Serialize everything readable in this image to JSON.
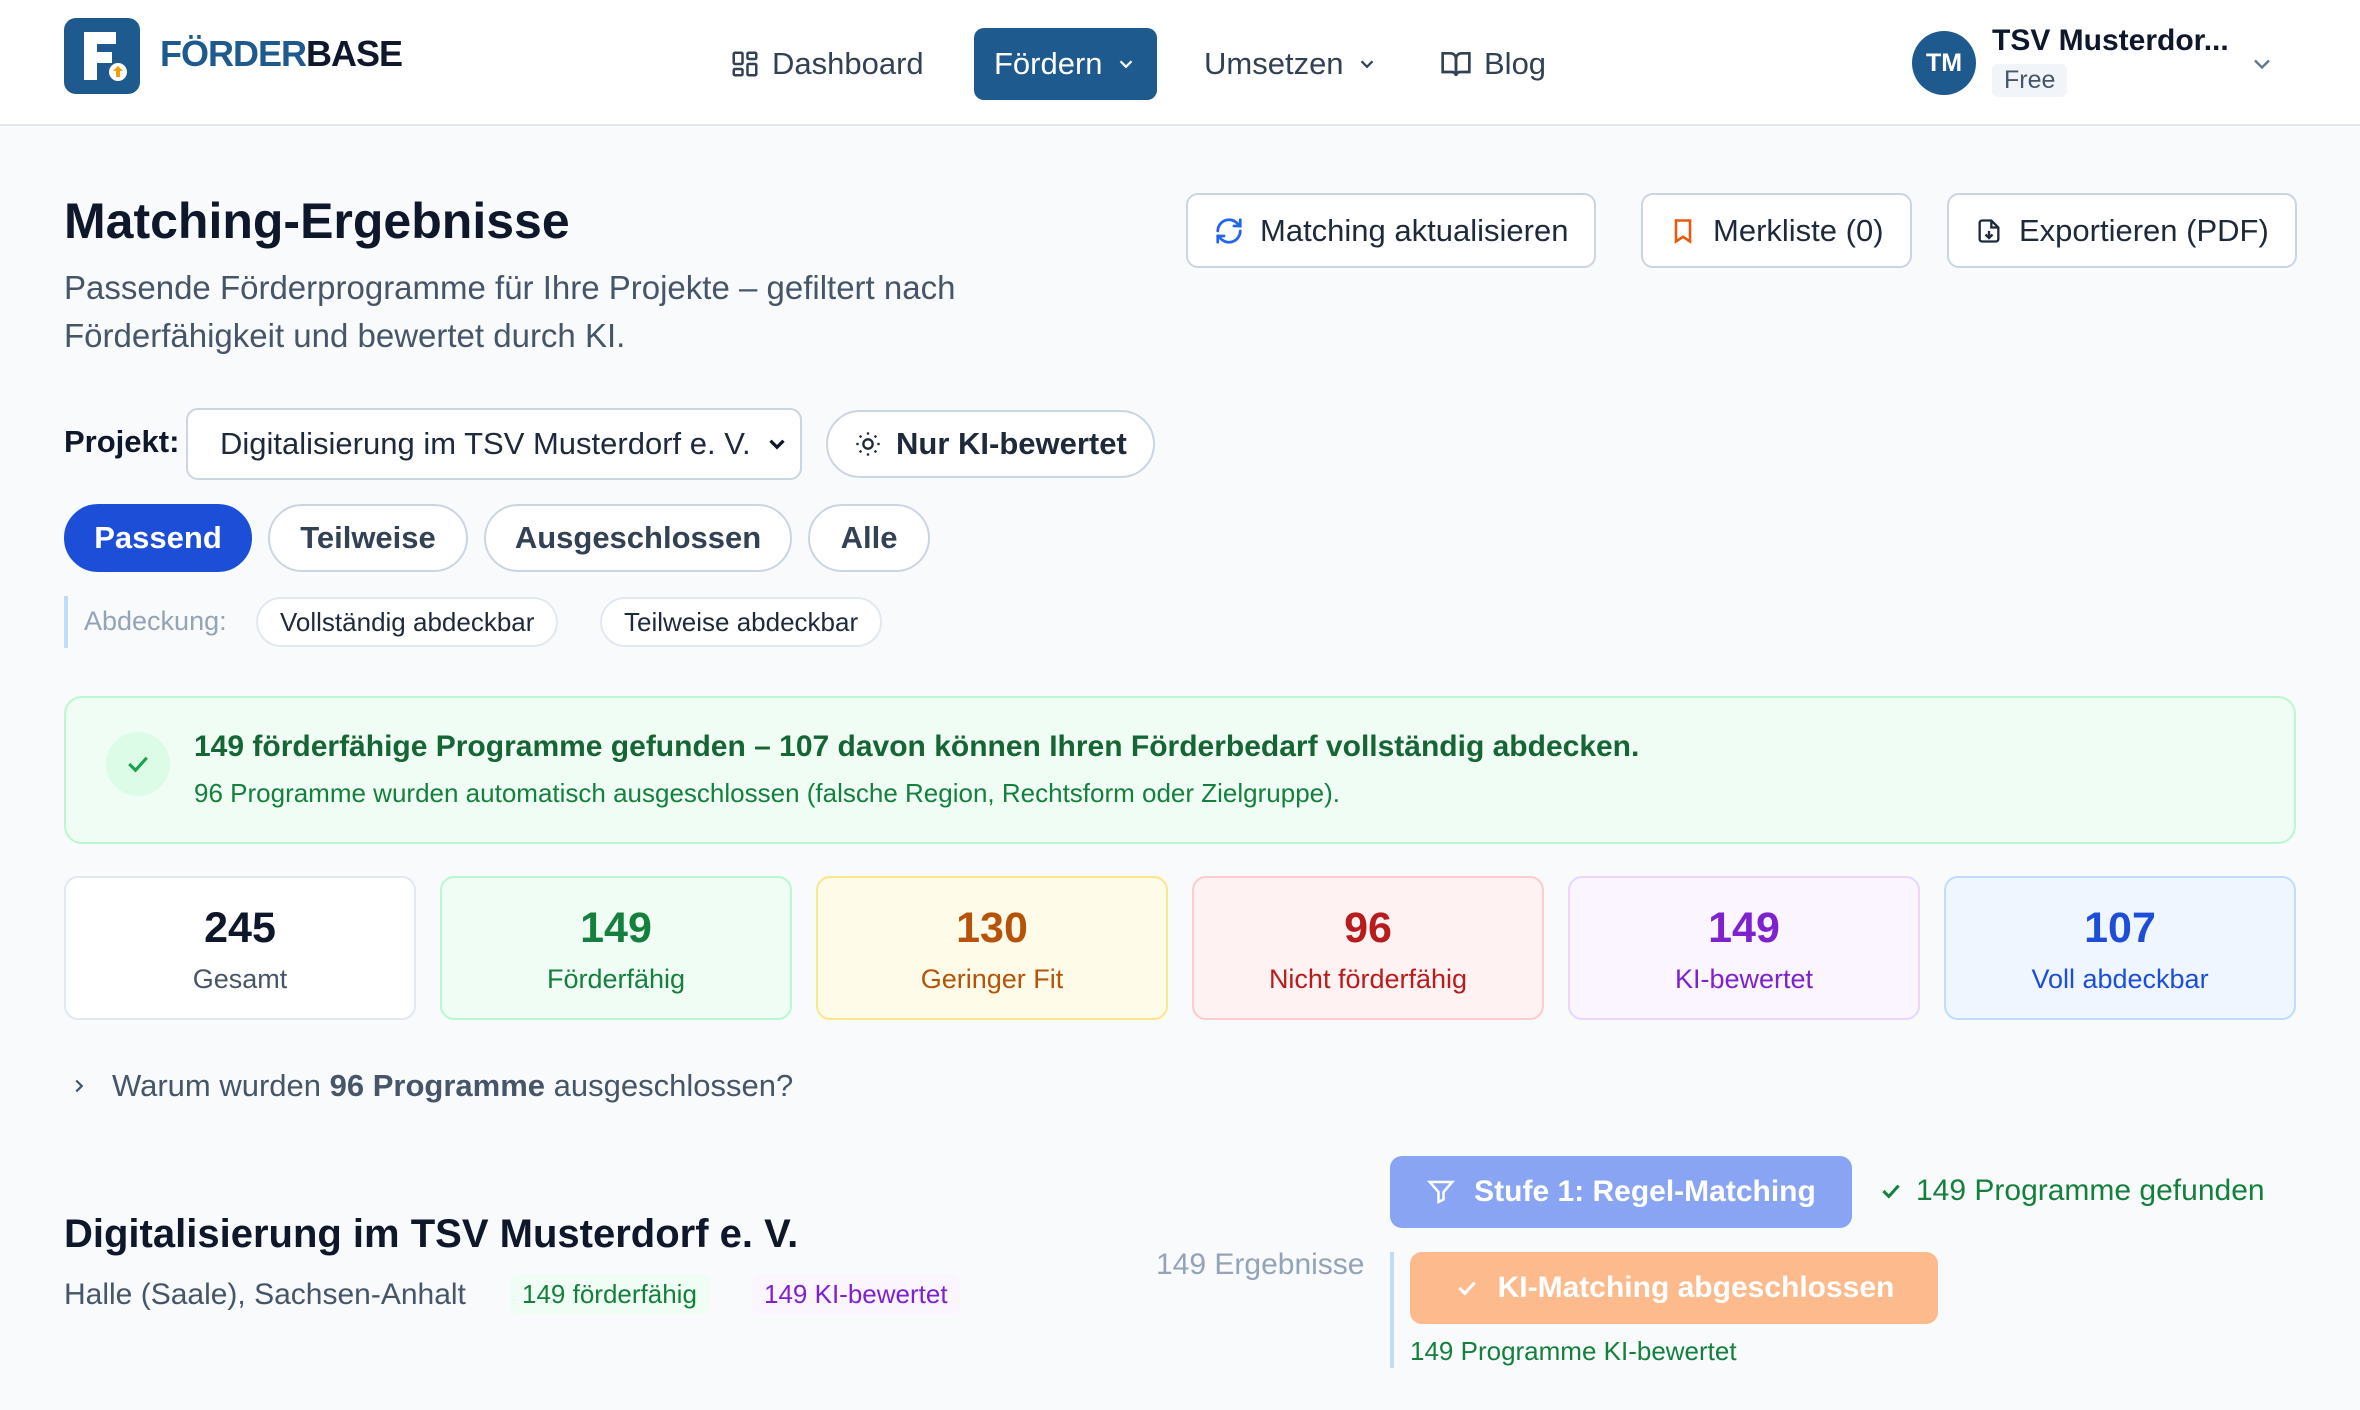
{
  "brand": {
    "name_part1": "FÖRDER",
    "name_part2": "BASE",
    "logo_letter": "F"
  },
  "nav": {
    "items": [
      {
        "label": "Dashboard",
        "icon": "grid-icon"
      },
      {
        "label": "Fördern",
        "icon": "chevron-down-icon",
        "active": true
      },
      {
        "label": "Umsetzen",
        "icon": "chevron-down-icon"
      },
      {
        "label": "Blog",
        "icon": "book-icon"
      }
    ]
  },
  "user": {
    "initials": "TM",
    "name": "TSV Musterdor...",
    "plan": "Free"
  },
  "page": {
    "title": "Matching-Ergebnisse",
    "subtitle": "Passende Förderprogramme für Ihre Projekte – gefiltert nach Förderfähigkeit und bewertet durch KI."
  },
  "actions": {
    "refresh": "Matching aktualisieren",
    "watchlist": "Merkliste (0)",
    "export": "Exportieren (PDF)"
  },
  "filters": {
    "project_label": "Projekt:",
    "project_selected": "Digitalisierung im TSV Musterdorf e. V.",
    "ki_only": "Nur KI-bewertet",
    "tabs": [
      "Passend",
      "Teilweise",
      "Ausgeschlossen",
      "Alle"
    ],
    "active_tab": "Passend",
    "coverage_label": "Abdeckung:",
    "coverage_options": [
      "Vollständig abdeckbar",
      "Teilweise abdeckbar"
    ]
  },
  "banner": {
    "title": "149 förderfähige Programme gefunden – 107 davon können Ihren Förderbedarf vollständig abdecken.",
    "text": "96 Programme wurden automatisch ausgeschlossen (falsche Region, Rechtsform oder Zielgruppe)."
  },
  "stats": [
    {
      "value": "245",
      "label": "Gesamt",
      "color": "#0f172a",
      "bg": "#ffffff",
      "border": "#e2e8f0"
    },
    {
      "value": "149",
      "label": "Förderfähig",
      "color": "#15803d",
      "bg": "#f0fdf4",
      "border": "#bbf7d0"
    },
    {
      "value": "130",
      "label": "Geringer Fit",
      "color": "#b45309",
      "bg": "#fefce8",
      "border": "#fde68a"
    },
    {
      "value": "96",
      "label": "Nicht förderfähig",
      "color": "#b91c1c",
      "bg": "#fef2f2",
      "border": "#fecaca"
    },
    {
      "value": "149",
      "label": "KI-bewertet",
      "color": "#7e22ce",
      "bg": "#faf5ff",
      "border": "#e9d5ff"
    },
    {
      "value": "107",
      "label": "Voll abdeckbar",
      "color": "#1d4ed8",
      "bg": "#eff6ff",
      "border": "#bfdbfe"
    }
  ],
  "why_excluded": {
    "prefix": "Warum wurden",
    "count": "96 Programme",
    "suffix": "ausgeschlossen?"
  },
  "project_section": {
    "title": "Digitalisierung im TSV Musterdorf e. V.",
    "location": "Halle (Saale), Sachsen-Anhalt",
    "tag_eligible": "149 förderfähig",
    "tag_ki": "149 KI-bewertet",
    "results_count": "149 Ergebnisse"
  },
  "stages": {
    "stage1_label": "Stufe 1: Regel-Matching",
    "stage1_result": "149 Programme gefunden",
    "stage2_label": "KI-Matching abgeschlossen",
    "stage2_result": "149 Programme KI-bewertet"
  }
}
